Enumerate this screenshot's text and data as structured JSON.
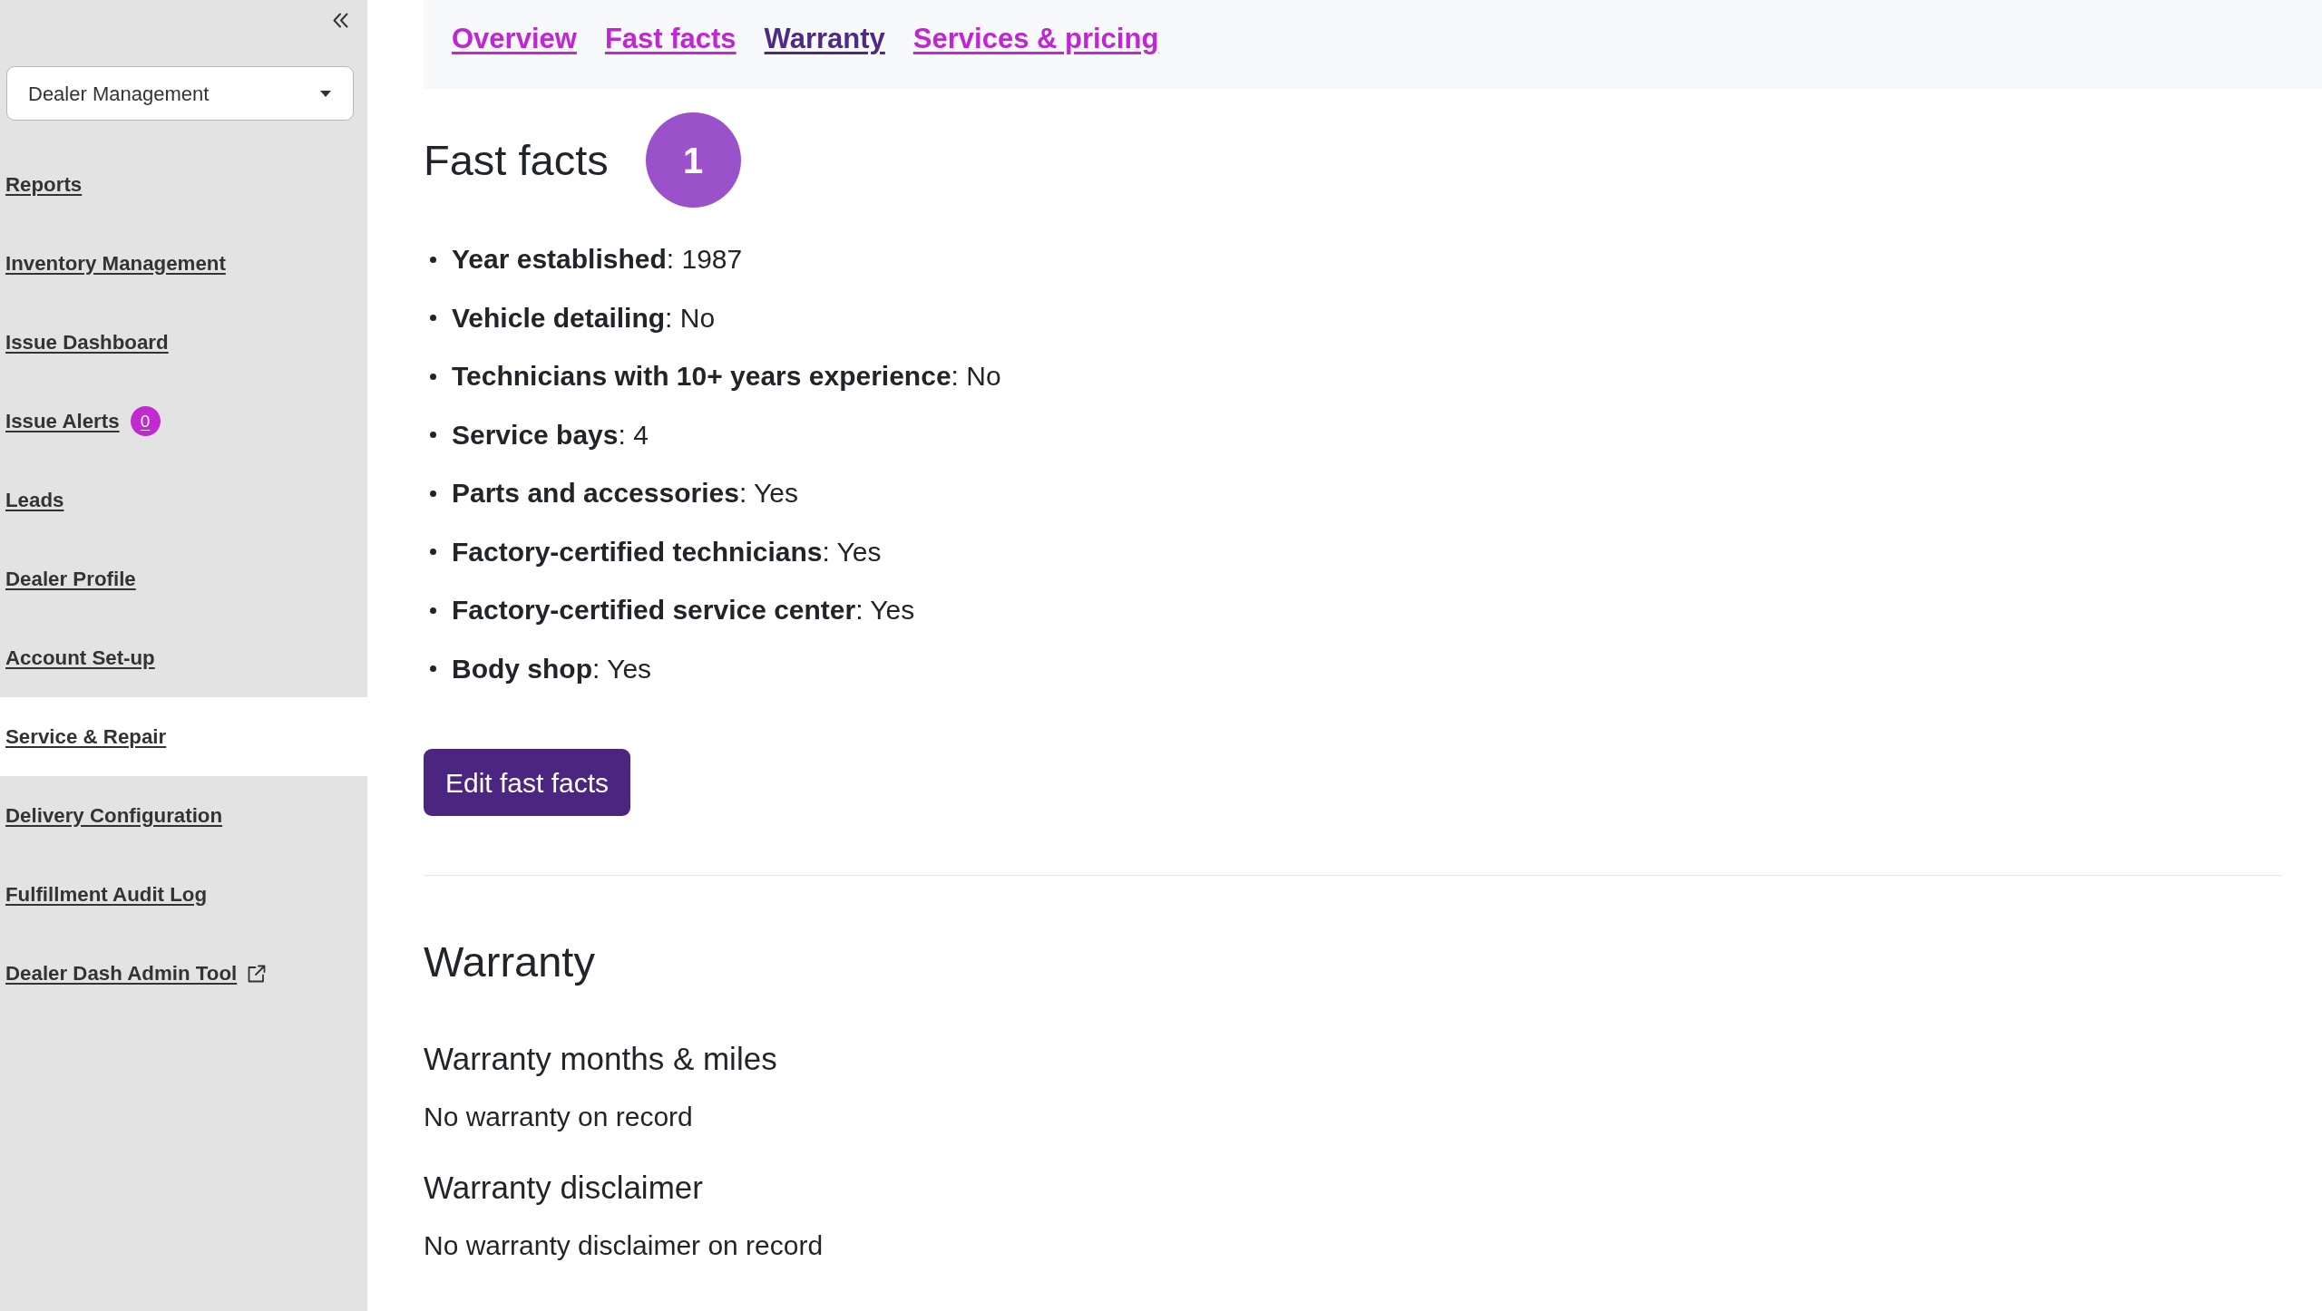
{
  "sidebar": {
    "dropdown": {
      "value": "Dealer Management"
    },
    "items": [
      {
        "label": "Reports",
        "selected": false,
        "external": false
      },
      {
        "label": "Inventory Management",
        "selected": false,
        "external": false
      },
      {
        "label": "Issue Dashboard",
        "selected": false,
        "external": false
      },
      {
        "label": "Issue Alerts",
        "selected": false,
        "external": false,
        "badge": "0"
      },
      {
        "label": "Leads",
        "selected": false,
        "external": false
      },
      {
        "label": "Dealer Profile",
        "selected": false,
        "external": false
      },
      {
        "label": "Account Set-up",
        "selected": false,
        "external": false
      },
      {
        "label": "Service & Repair",
        "selected": true,
        "external": false
      },
      {
        "label": "Delivery Configuration",
        "selected": false,
        "external": false
      },
      {
        "label": "Fulfillment Audit Log",
        "selected": false,
        "external": false
      },
      {
        "label": "Dealer Dash Admin Tool",
        "selected": false,
        "external": true
      }
    ]
  },
  "tabs": [
    {
      "label": "Overview",
      "selected": false
    },
    {
      "label": "Fast facts",
      "selected": false
    },
    {
      "label": "Warranty",
      "selected": true
    },
    {
      "label": "Services & pricing",
      "selected": false
    }
  ],
  "fast_facts": {
    "title": "Fast facts",
    "step": "1",
    "facts": [
      "**Year established**: 1987",
      "**Vehicle detailing**: No",
      "**Technicians with 10+ years experience**: No",
      "**Service bays**: 4",
      "**Parts and accessories**: Yes",
      "**Factory-certified technicians**: Yes",
      "**Factory-certified service center**: Yes",
      "**Body shop**: Yes"
    ],
    "edit_button": "Edit fast facts"
  },
  "warranty": {
    "title": "Warranty",
    "sections": [
      {
        "heading": "Warranty months & miles",
        "text": "No warranty on record"
      },
      {
        "heading": "Warranty disclaimer",
        "text": "No warranty disclaimer on record"
      }
    ]
  }
}
